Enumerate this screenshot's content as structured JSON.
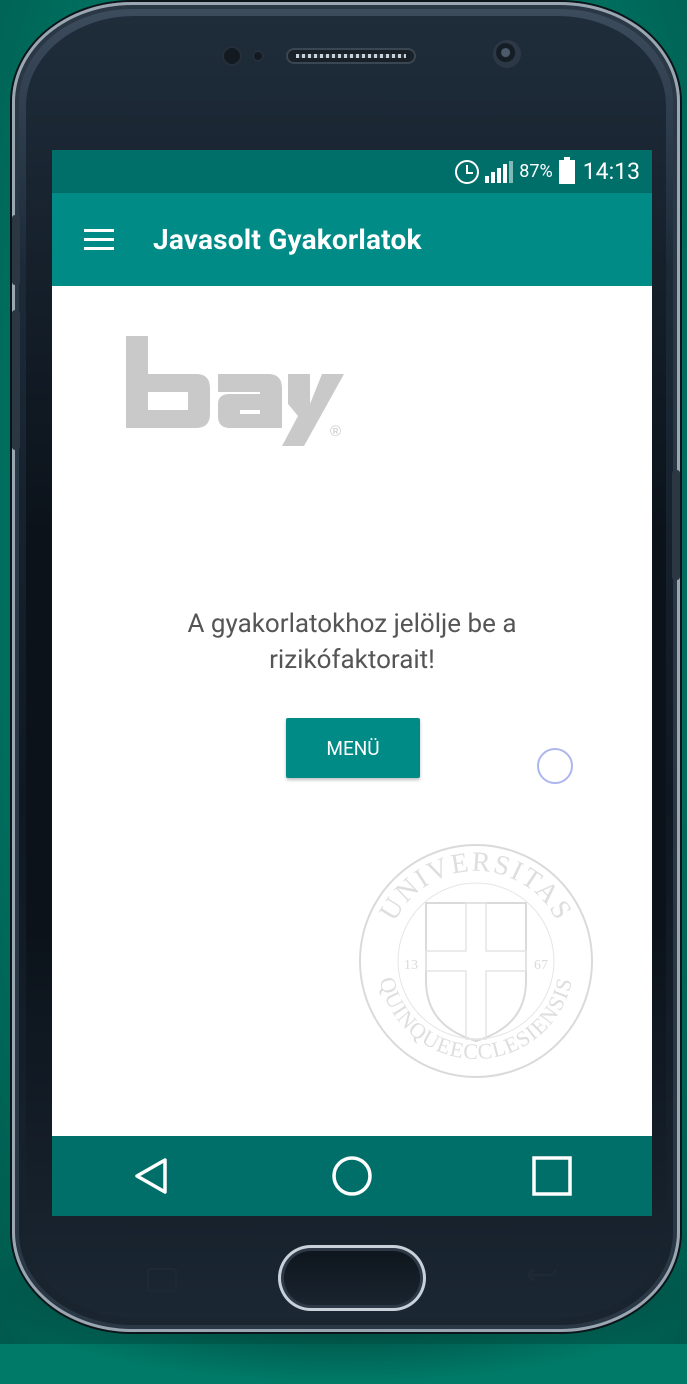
{
  "status_bar": {
    "battery_percent": "87%",
    "time": "14:13",
    "icons": [
      "alarm-icon",
      "signal-icon",
      "battery-icon"
    ]
  },
  "app_bar": {
    "title": "Javasolt Gyakorlatok",
    "menu_icon": "hamburger-menu-icon"
  },
  "content": {
    "logo_text": "bay",
    "logo_registered": "®",
    "message": "A gyakorlatokhoz jelölje be a rizikófaktorait!",
    "menu_button_label": "MENÜ",
    "seal": {
      "top_text": "UNIVERSITAS",
      "bottom_text": "QUINQUEECCLESIENSIS",
      "left_number": "13",
      "right_number": "67"
    }
  },
  "nav_bar": {
    "buttons": [
      "back-triangle-icon",
      "home-circle-icon",
      "recents-square-icon"
    ]
  },
  "colors": {
    "status_bar": "#006f6a",
    "app_bar": "#008b87",
    "accent": "#008b87",
    "background": "#007a68"
  }
}
